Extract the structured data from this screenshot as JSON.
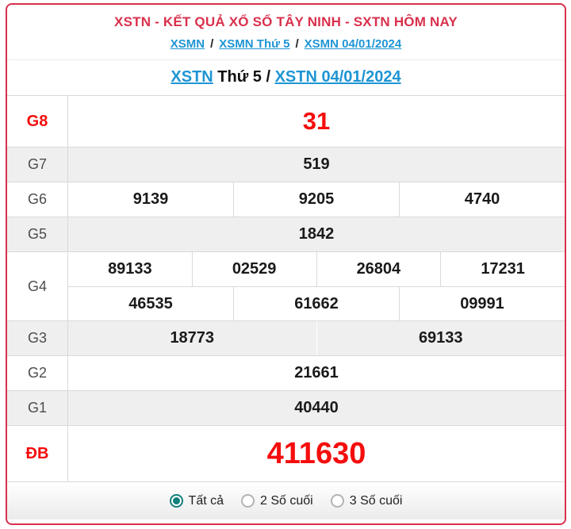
{
  "page": {
    "title": "XSTN - KẾT QUẢ XỔ SỐ TÂY NINH - SXTN HÔM NAY"
  },
  "breadcrumb": {
    "separator": "/",
    "items": [
      {
        "label": "XSMN"
      },
      {
        "label": "XSMN Thứ 5"
      },
      {
        "label": "XSMN 04/01/2024"
      }
    ]
  },
  "subtitle": {
    "link1": "XSTN",
    "middle": " Thứ 5 / ",
    "link2": "XSTN 04/01/2024"
  },
  "results_table": {
    "rows": [
      {
        "label": "G8",
        "kind": "g8",
        "lines": [
          [
            "31"
          ]
        ]
      },
      {
        "label": "G7",
        "kind": "normal",
        "lines": [
          [
            "519"
          ]
        ]
      },
      {
        "label": "G6",
        "kind": "normal",
        "lines": [
          [
            "9139",
            "9205",
            "4740"
          ]
        ]
      },
      {
        "label": "G5",
        "kind": "normal",
        "lines": [
          [
            "1842"
          ]
        ]
      },
      {
        "label": "G4",
        "kind": "normal",
        "lines": [
          [
            "89133",
            "02529",
            "26804",
            "17231"
          ],
          [
            "46535",
            "61662",
            "09991"
          ]
        ]
      },
      {
        "label": "G3",
        "kind": "normal",
        "lines": [
          [
            "18773",
            "69133"
          ]
        ]
      },
      {
        "label": "G2",
        "kind": "normal",
        "lines": [
          [
            "21661"
          ]
        ]
      },
      {
        "label": "G1",
        "kind": "normal",
        "lines": [
          [
            "40440"
          ]
        ]
      },
      {
        "label": "ĐB",
        "kind": "db",
        "lines": [
          [
            "411630"
          ]
        ]
      }
    ]
  },
  "footer": {
    "options": [
      {
        "label": "Tất cả",
        "selected": true
      },
      {
        "label": "2 Số cuối",
        "selected": false
      },
      {
        "label": "3 Số cuối",
        "selected": false
      }
    ]
  },
  "colors": {
    "accent_red": "#d9304c",
    "number_red": "#f50d0d",
    "link_blue": "#1e95d4",
    "row_alt_bg": "#efefef",
    "radio_teal": "#0f7f7c"
  }
}
